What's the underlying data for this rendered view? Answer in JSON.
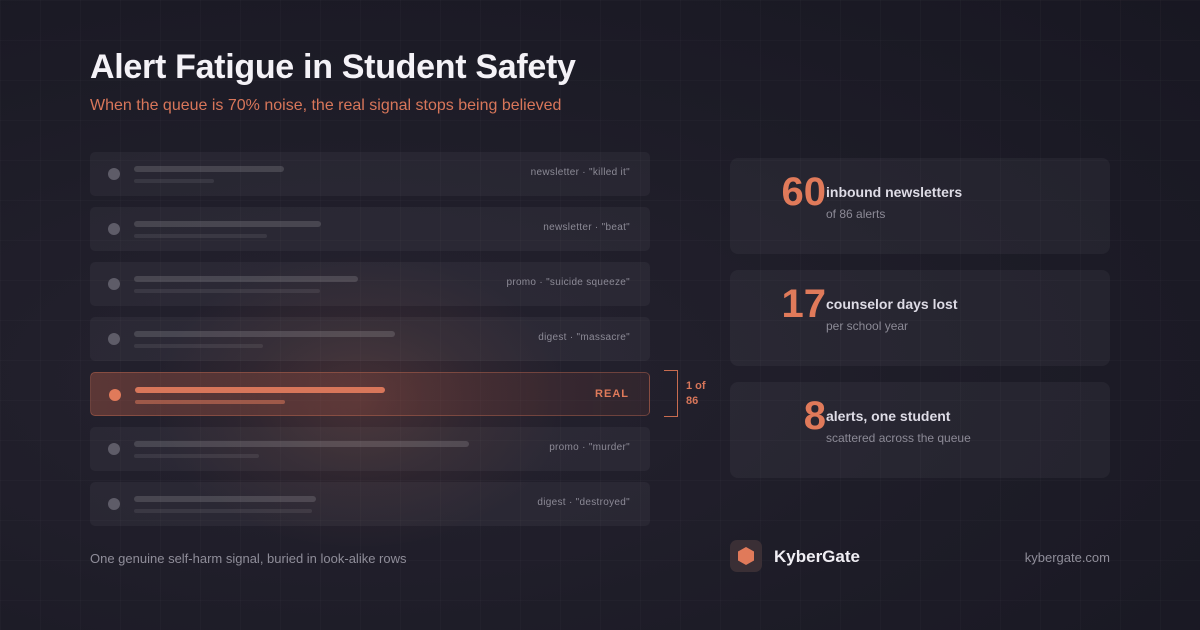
{
  "header": {
    "title": "Alert Fatigue in Student Safety",
    "subtitle": "When the queue is 70% noise, the real signal stops being believed"
  },
  "rows": [
    {
      "tag": "newsletter · \"killed it\"",
      "real": false
    },
    {
      "tag": "newsletter · \"beat\"",
      "real": false
    },
    {
      "tag": "promo · \"suicide squeeze\"",
      "real": false
    },
    {
      "tag": "digest · \"massacre\"",
      "real": false
    },
    {
      "tag": "REAL",
      "real": true
    },
    {
      "tag": "promo · \"murder\"",
      "real": false
    },
    {
      "tag": "digest · \"destroyed\"",
      "real": false
    }
  ],
  "bracket": {
    "line1": "1 of",
    "line2": "86"
  },
  "caption": "One genuine self-harm signal, buried in look-alike rows",
  "stats": [
    {
      "number": "60",
      "label": "inbound newsletters",
      "sub": "of 86 alerts"
    },
    {
      "number": "17",
      "label": "counselor days lost",
      "sub": "per school year"
    },
    {
      "number": "8",
      "label": "alerts, one student",
      "sub": "scattered across the queue"
    }
  ],
  "brand": {
    "name": "KyberGate",
    "url": "kybergate.com",
    "icon": "hexagon-icon"
  },
  "colors": {
    "accent": "#e07a5a",
    "background": "#1d1c27"
  }
}
